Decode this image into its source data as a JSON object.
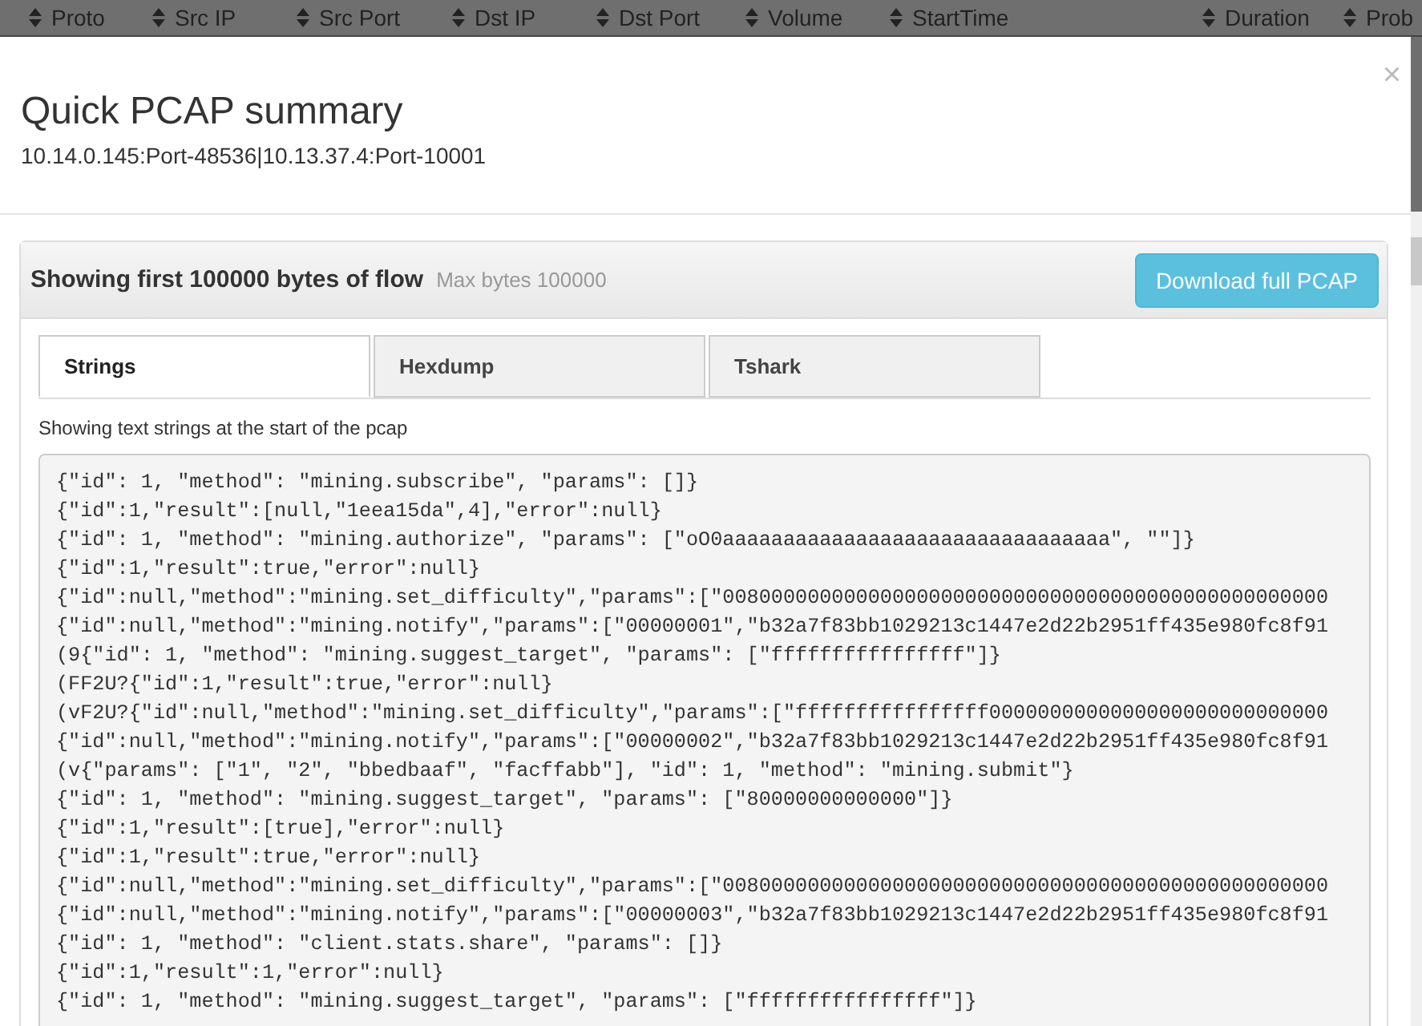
{
  "table_header": {
    "columns": [
      "Proto",
      "Src IP",
      "Src Port",
      "Dst IP",
      "Dst Port",
      "Volume",
      "StartTime",
      "Duration",
      "Prob"
    ]
  },
  "modal": {
    "close": "×",
    "title": "Quick PCAP summary",
    "subtitle": "10.14.0.145:Port-48536|10.13.37.4:Port-10001",
    "panel": {
      "heading": "Showing first 100000 bytes of flow",
      "note": "Max bytes 100000",
      "button": "Download full PCAP",
      "tabs": [
        {
          "label": "Strings",
          "selected": true
        },
        {
          "label": "Hexdump",
          "selected": false
        },
        {
          "label": "Tshark",
          "selected": false
        }
      ],
      "description": "Showing text strings at the start of the pcap",
      "lines": [
        "{\"id\": 1, \"method\": \"mining.subscribe\", \"params\": []}",
        "{\"id\":1,\"result\":[null,\"1eea15da\",4],\"error\":null}",
        "{\"id\": 1, \"method\": \"mining.authorize\", \"params\": [\"oO0aaaaaaaaaaaaaaaaaaaaaaaaaaaaaaaa\", \"\"]}",
        "{\"id\":1,\"result\":true,\"error\":null}",
        "{\"id\":null,\"method\":\"mining.set_difficulty\",\"params\":[\"00800000000000000000000000000000000000000000000000",
        "{\"id\":null,\"method\":\"mining.notify\",\"params\":[\"00000001\",\"b32a7f83bb1029213c1447e2d22b2951ff435e980fc8f91",
        "(9{\"id\": 1, \"method\": \"mining.suggest_target\", \"params\": [\"ffffffffffffffff\"]}",
        "(FF2U?{\"id\":1,\"result\":true,\"error\":null}",
        "(vF2U?{\"id\":null,\"method\":\"mining.set_difficulty\",\"params\":[\"ffffffffffffffff0000000000000000000000000000",
        "{\"id\":null,\"method\":\"mining.notify\",\"params\":[\"00000002\",\"b32a7f83bb1029213c1447e2d22b2951ff435e980fc8f91",
        "(v{\"params\": [\"1\", \"2\", \"bbedbaaf\", \"facffabb\"], \"id\": 1, \"method\": \"mining.submit\"}",
        "{\"id\": 1, \"method\": \"mining.suggest_target\", \"params\": [\"80000000000000\"]}",
        "{\"id\":1,\"result\":[true],\"error\":null}",
        "{\"id\":1,\"result\":true,\"error\":null}",
        "{\"id\":null,\"method\":\"mining.set_difficulty\",\"params\":[\"00800000000000000000000000000000000000000000000000",
        "{\"id\":null,\"method\":\"mining.notify\",\"params\":[\"00000003\",\"b32a7f83bb1029213c1447e2d22b2951ff435e980fc8f91",
        "{\"id\": 1, \"method\": \"client.stats.share\", \"params\": []}",
        "{\"id\":1,\"result\":1,\"error\":null}",
        "{\"id\": 1, \"method\": \"mining.suggest_target\", \"params\": [\"ffffffffffffffff\"]}"
      ]
    }
  }
}
